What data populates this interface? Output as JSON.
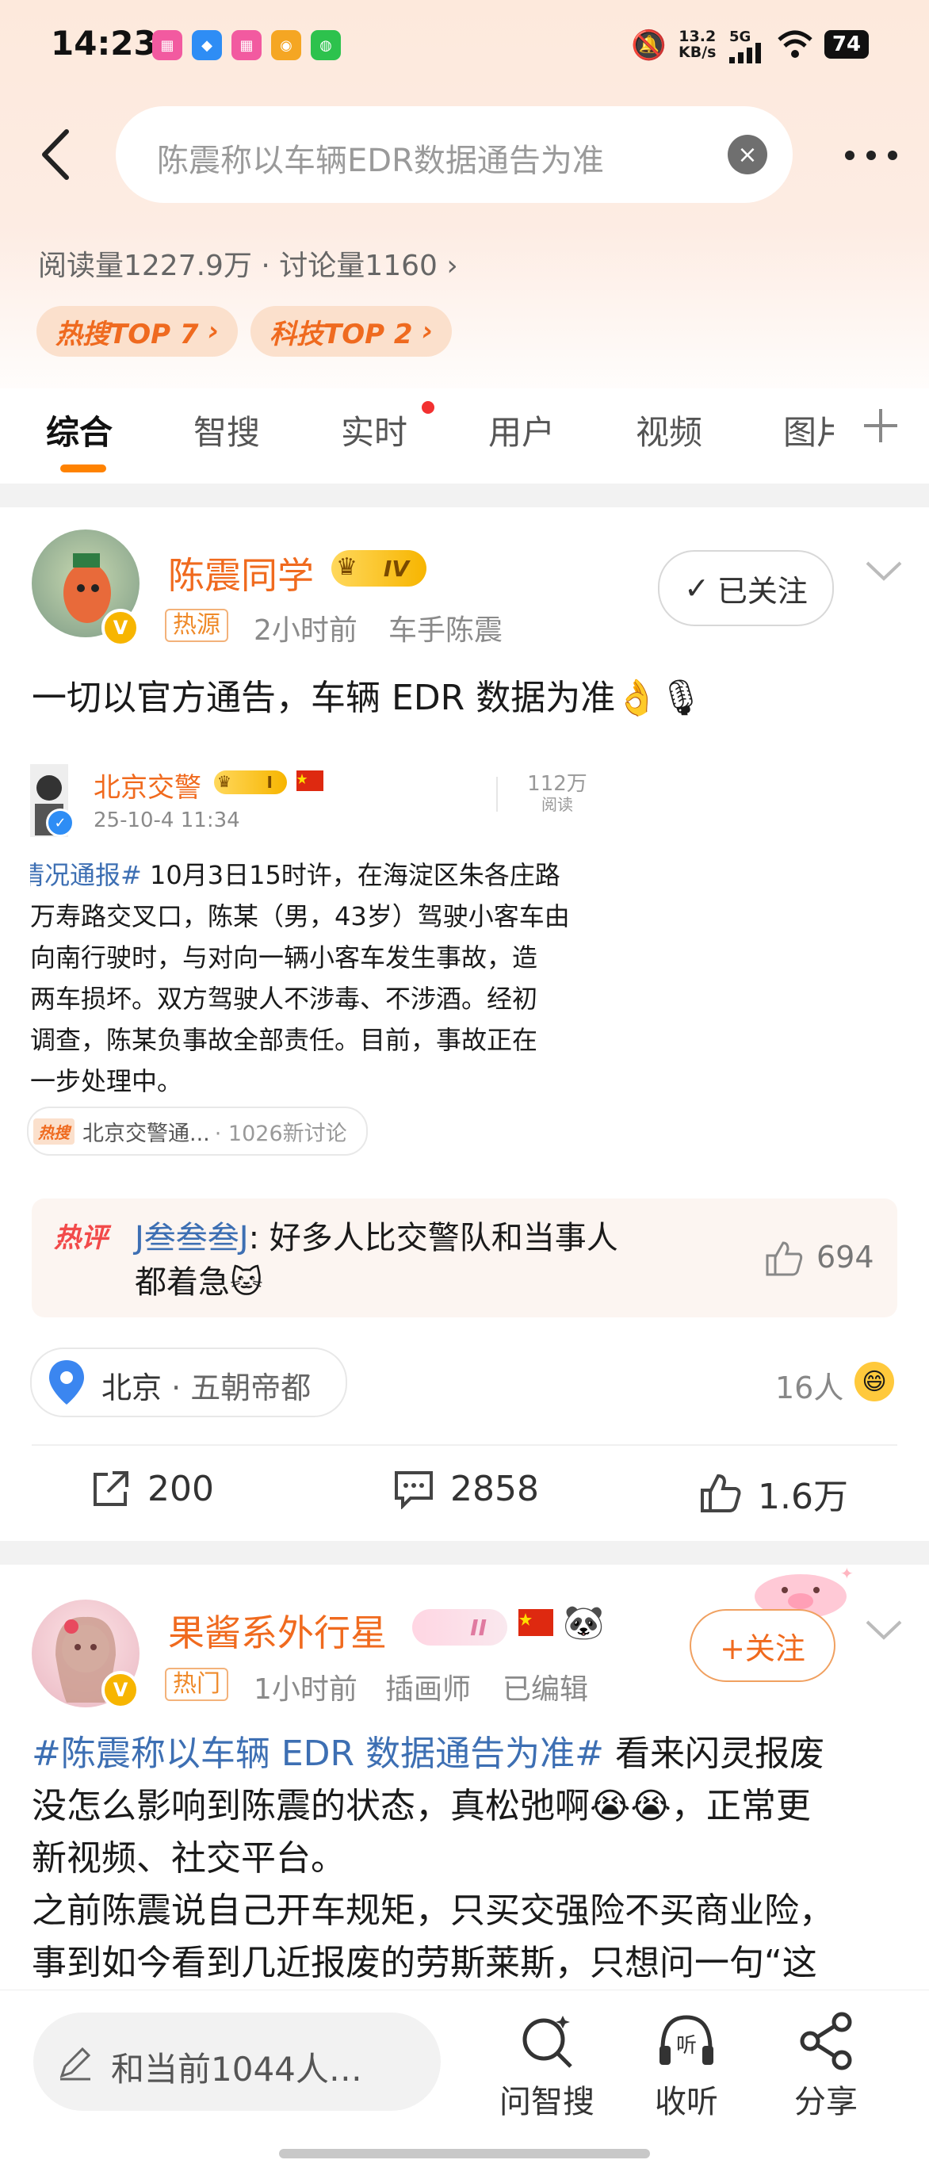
{
  "status_bar": {
    "time": "14:23",
    "net_speed_top": "13.2",
    "net_speed_bottom": "KB/s",
    "signal": "5G",
    "battery": "74"
  },
  "search": {
    "query": "陈震称以车辆EDR数据通告为准",
    "clear_icon": "close-circle-icon",
    "back_icon": "back-arrow-icon",
    "more_icon": "more-dots-icon"
  },
  "topic": {
    "stats": "阅读量1227.9万 · 讨论量1160",
    "badges": [
      "热搜TOP 7",
      "科技TOP 2"
    ]
  },
  "tabs": [
    "综合",
    "智搜",
    "实时",
    "用户",
    "视频",
    "图片"
  ],
  "tabs_add_icon": "plus-icon",
  "post1": {
    "username": "陈震同学",
    "level_badge": "IV",
    "verified_badge": "V",
    "tag": "热源",
    "time": "2小时前",
    "source": "车手陈震",
    "follow_label": "已关注",
    "text": "一切以官方通告，车辆 EDR 数据为准👌🎙",
    "repost": {
      "author": "北京交警",
      "level_badge": "I",
      "date": "25-10-4 11:34",
      "reads_value": "112万",
      "reads_label": "阅读",
      "text_tag": "情况通报#",
      "text_lines": [
        " 10月3日15时许，在海淀区朱各庄路",
        "万寿路交叉口，陈某（男，43岁）驾驶小客车由",
        "向南行驶时，与对向一辆小客车发生事故，造",
        "两车损坏。双方驾驶人不涉毒、不涉酒。经初",
        "调查，陈某负事故全部责任。目前，事故正在",
        "一步处理中。"
      ],
      "hot_tag": "热搜",
      "hot_title": "北京交警通...",
      "hot_count": "· 1026新讨论"
    },
    "hot_comment": {
      "label": "热评",
      "user": "J叁叁叁J",
      "text_line1": ": 好多人比交警队和当事人",
      "text_line2": "都着急🐱",
      "likes": "694"
    },
    "location": {
      "city": "北京",
      "place": "· 五朝帝都"
    },
    "reactors": "16人",
    "actions": {
      "repost": "200",
      "comment": "2858",
      "like": "1.6万"
    }
  },
  "post2": {
    "username": "果酱系外行星",
    "level_badge": "II",
    "verified_badge": "V",
    "tag": "热门",
    "time": "1小时前",
    "source": "插画师",
    "edited": "已编辑",
    "follow_label": "+关注",
    "hashtag": "#陈震称以车辆 EDR 数据通告为准#",
    "text_line1_tail": " 看来闪灵报废",
    "text_line2": "没怎么影响到陈震的状态，真松弛啊😭😭，正常更",
    "text_line3": "新视频、社交平台。",
    "text_line4": "之前陈震说自己开车规矩，只买交强险不买商业险，",
    "text_line5": "事到如今看到几近报废的劳斯莱斯，只想问一句“这"
  },
  "bottom_bar": {
    "comment_placeholder": "和当前1044人…",
    "buttons": [
      "问智搜",
      "收听",
      "分享"
    ]
  },
  "colors": {
    "accent": "#ff8200",
    "username": "#f06a1e",
    "hashtag_link": "#3d6fb3"
  }
}
